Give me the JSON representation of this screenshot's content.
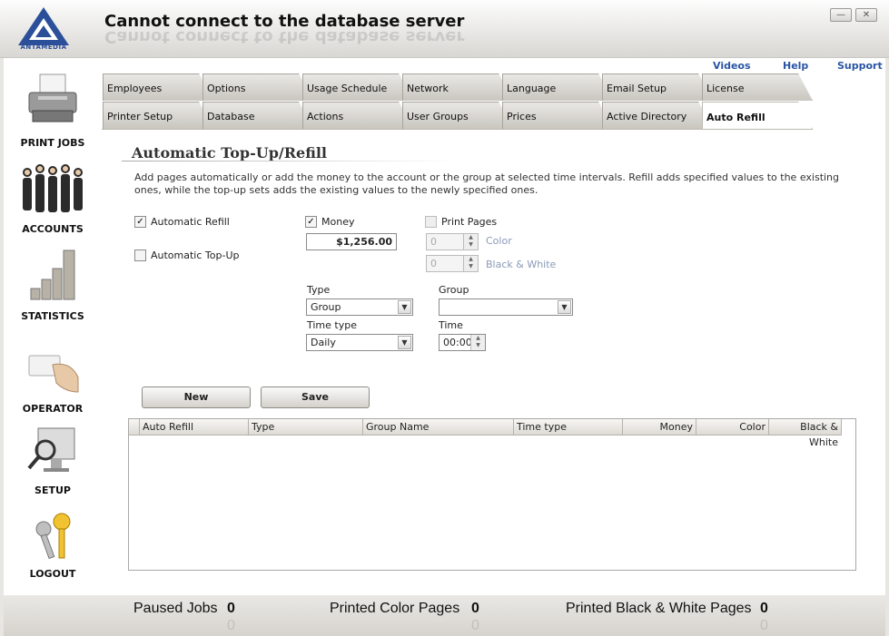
{
  "window": {
    "title": "Cannot connect to the database server",
    "logo_text": "ANTAMEDIA",
    "minimize_glyph": "—",
    "close_glyph": "✕"
  },
  "sidebar": {
    "items": [
      {
        "label": "PRINT JOBS",
        "icon": "printer-icon"
      },
      {
        "label": "ACCOUNTS",
        "icon": "people-icon"
      },
      {
        "label": "STATISTICS",
        "icon": "chart-icon"
      },
      {
        "label": "OPERATOR",
        "icon": "card-hand-icon"
      },
      {
        "label": "SETUP",
        "icon": "monitor-magnifier-icon"
      },
      {
        "label": "LOGOUT",
        "icon": "keys-icon"
      }
    ]
  },
  "toplinks": [
    "Videos",
    "Help",
    "Support"
  ],
  "tabs": {
    "row1": [
      "Employees",
      "Options",
      "Usage Schedule",
      "Network",
      "Language",
      "Email Setup",
      "License"
    ],
    "row2": [
      "Printer Setup",
      "Database",
      "Actions",
      "User Groups",
      "Prices",
      "Active Directory",
      "Auto Refill"
    ],
    "active": "Auto Refill"
  },
  "panel": {
    "heading": "Automatic Top-Up/Refill",
    "description": "Add pages automatically or add the money to the account or the group at selected time intervals. Refill adds specified values to the existing ones, while the top-up sets adds the existing values to the newly specified ones."
  },
  "form": {
    "automatic_refill": {
      "label": "Automatic Refill",
      "checked": true
    },
    "automatic_topup": {
      "label": "Automatic Top-Up",
      "checked": false
    },
    "money": {
      "label": "Money",
      "checked": true,
      "value": "$1,256.00"
    },
    "print_pages": {
      "label": "Print Pages",
      "checked": false
    },
    "color": {
      "label": "Color",
      "value": "0"
    },
    "bw": {
      "label": "Black & White",
      "value": "0"
    },
    "type": {
      "label": "Type",
      "value": "Group"
    },
    "group": {
      "label": "Group",
      "value": ""
    },
    "time_type": {
      "label": "Time type",
      "value": "Daily"
    },
    "time": {
      "label": "Time",
      "value": "00:00"
    },
    "check_glyph": "✓"
  },
  "buttons": {
    "new": "New",
    "save": "Save"
  },
  "grid": {
    "columns": [
      "Auto Refill",
      "Type",
      "Group Name",
      "Time type",
      "Money",
      "Color",
      "Black & White"
    ],
    "rows": []
  },
  "status": {
    "paused_label": "Paused Jobs",
    "paused_value": "0",
    "color_label": "Printed Color Pages",
    "color_value": "0",
    "bw_label": "Printed Black & White Pages",
    "bw_value": "0"
  },
  "colors": {
    "link": "#2a55a5",
    "logo": "#2c4f9a"
  }
}
